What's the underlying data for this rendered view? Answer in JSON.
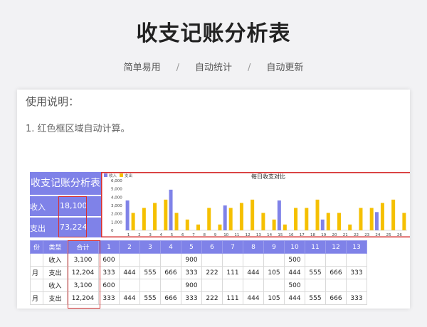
{
  "header": {
    "title": "收支记账分析表",
    "tags": [
      "简单易用",
      "自动统计",
      "自动更新"
    ]
  },
  "usage": {
    "title": "使用说明：",
    "lines": [
      "1. 红色框区域自动计算。"
    ]
  },
  "summary": {
    "title": "收支记账分析表",
    "income_label": "收入",
    "income_value": "18,100",
    "expense_label": "支出",
    "expense_value": "73,224"
  },
  "table": {
    "headers": [
      "份",
      "类型",
      "合计",
      "1",
      "2",
      "3",
      "4",
      "5",
      "6",
      "7",
      "8",
      "9",
      "10",
      "11",
      "12",
      "13"
    ],
    "rows": [
      {
        "month": "",
        "type": "收入",
        "total": "3,100",
        "days": [
          "600",
          "",
          "",
          "",
          "900",
          "",
          "",
          "",
          "",
          "500",
          "",
          "",
          ""
        ]
      },
      {
        "month": "月",
        "type": "支出",
        "total": "12,204",
        "days": [
          "333",
          "444",
          "555",
          "666",
          "333",
          "222",
          "111",
          "444",
          "105",
          "444",
          "555",
          "666",
          "333"
        ]
      },
      {
        "month": "",
        "type": "收入",
        "total": "3,100",
        "days": [
          "600",
          "",
          "",
          "",
          "900",
          "",
          "",
          "",
          "",
          "500",
          "",
          "",
          ""
        ]
      },
      {
        "month": "月",
        "type": "支出",
        "total": "12,204",
        "days": [
          "333",
          "444",
          "555",
          "666",
          "333",
          "222",
          "111",
          "444",
          "105",
          "444",
          "555",
          "666",
          "333"
        ]
      }
    ]
  },
  "chart_data": {
    "type": "bar",
    "title": "每日收支对比",
    "legend": [
      "收入",
      "支出"
    ],
    "legend_position": "top-left",
    "ylim": [
      0,
      6000
    ],
    "yticks": [
      "0",
      "1,000",
      "2,000",
      "3,000",
      "4,000",
      "5,000",
      "6,000"
    ],
    "categories": [
      "1",
      "2",
      "3",
      "4",
      "5",
      "6",
      "7",
      "8",
      "9",
      "10",
      "11",
      "12",
      "13",
      "14",
      "15",
      "16",
      "17",
      "18",
      "19",
      "20",
      "21",
      "22",
      "23",
      "24",
      "25",
      "26"
    ],
    "series": [
      {
        "name": "收入",
        "color": "#7f82e8",
        "values": [
          3600,
          0,
          0,
          0,
          4900,
          0,
          0,
          0,
          0,
          3000,
          0,
          0,
          0,
          0,
          3600,
          0,
          0,
          0,
          1300,
          0,
          0,
          0,
          0,
          2200,
          0,
          0
        ]
      },
      {
        "name": "支出",
        "color": "#f5c000",
        "values": [
          2100,
          2700,
          3300,
          3700,
          2100,
          1300,
          700,
          2700,
          700,
          2700,
          3300,
          3700,
          2100,
          1300,
          700,
          2700,
          2700,
          3700,
          2100,
          2100,
          700,
          2700,
          2700,
          3300,
          3700,
          2100
        ]
      }
    ]
  },
  "colors": {
    "header_fill": "#7f82e8",
    "income": "#7f82e8",
    "expense": "#f5c000",
    "highlight_border": "#d63030"
  }
}
